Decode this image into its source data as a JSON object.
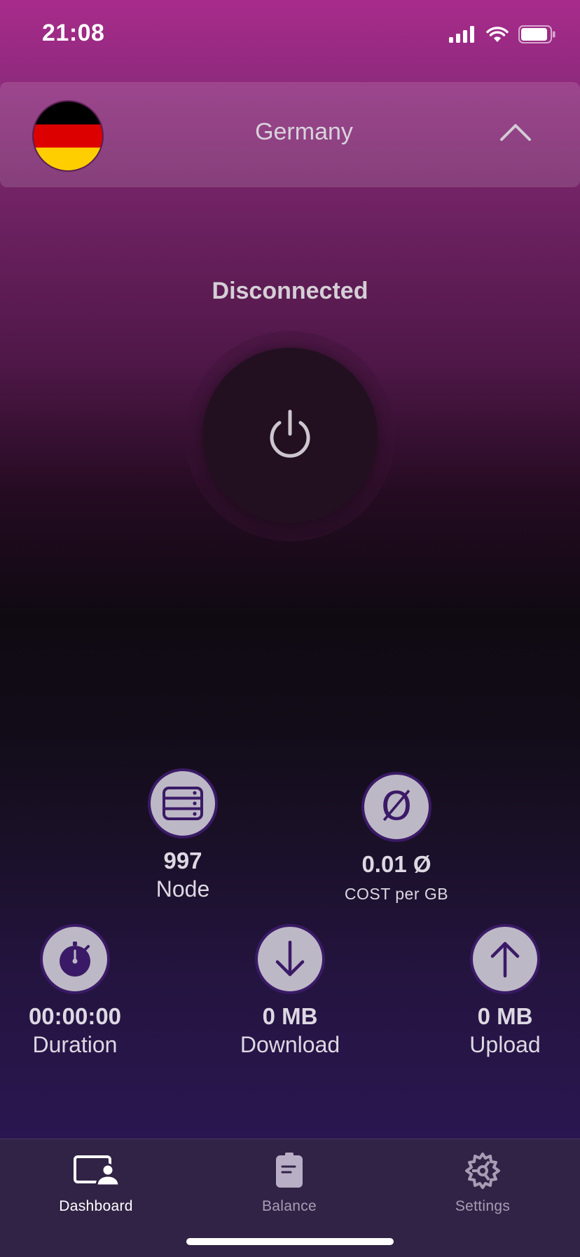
{
  "status_bar": {
    "time": "21:08",
    "icons": [
      "signal-icon",
      "wifi-icon",
      "battery-icon"
    ]
  },
  "country_selector": {
    "country": "Germany",
    "flag": "germany-flag",
    "toggle_icon": "chevron-up-icon"
  },
  "connection": {
    "status": "Disconnected",
    "button_icon": "power-icon"
  },
  "stats": {
    "node": {
      "value": "997",
      "label": "Node",
      "icon": "server-icon"
    },
    "cost": {
      "value": "0.01 Ø",
      "label": "COST per GB",
      "icon_text": "Ø"
    },
    "duration": {
      "value": "00:00:00",
      "label": "Duration",
      "icon": "stopwatch-icon"
    },
    "download": {
      "value": "0 MB",
      "label": "Download",
      "icon": "arrow-down-icon"
    },
    "upload": {
      "value": "0 MB",
      "label": "Upload",
      "icon": "arrow-up-icon"
    }
  },
  "tab_bar": {
    "tabs": [
      {
        "label": "Dashboard",
        "icon": "dashboard-icon",
        "active": true
      },
      {
        "label": "Balance",
        "icon": "balance-icon",
        "active": false
      },
      {
        "label": "Settings",
        "icon": "settings-icon",
        "active": false
      }
    ]
  },
  "colors": {
    "accent_purple": "#3a1a66",
    "stat_icon_bg": "#bdb8c6",
    "tab_bar_bg": "#312345"
  }
}
